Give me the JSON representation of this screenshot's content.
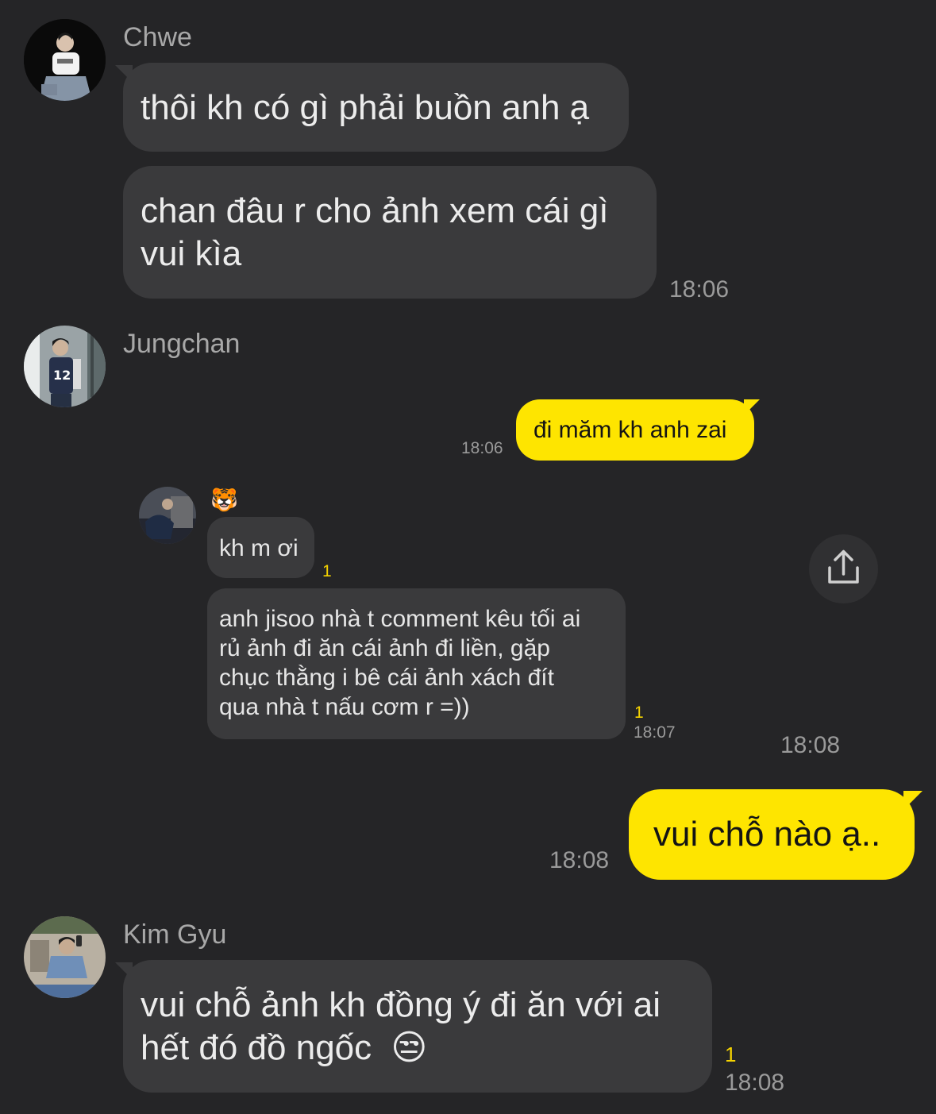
{
  "messages": {
    "chwe": {
      "sender": "Chwe",
      "bubble1": "thôi kh có gì phải buồn anh ạ",
      "bubble2_line1": "chan đâu r cho ảnh xem cái gì",
      "bubble2_line2": "vui kìa",
      "time": "18:06"
    },
    "jungchan": {
      "sender": "Jungchan",
      "shared_post": {
        "reply_text": "đi măm kh anh zai",
        "reply_time": "18:06",
        "inner_sender_emoji": "🐯",
        "inner_msg1": "kh m ơi",
        "inner_msg1_unread": "1",
        "inner_msg2_lines": [
          "anh jisoo nhà t comment kêu tối ai",
          "rủ ảnh đi ăn cái ảnh đi liền, gặp",
          "chục thằng i bê cái ảnh xách đít",
          "qua nhà t nấu cơm r =))"
        ],
        "inner_msg2_unread": "1",
        "inner_msg2_time": "18:07"
      },
      "time": "18:08"
    },
    "me": {
      "text": "vui chỗ nào ạ..",
      "time": "18:08"
    },
    "kimgyu": {
      "sender": "Kim Gyu",
      "line1": "vui chỗ ảnh kh đồng ý đi ăn với ai",
      "line2": "hết đó đồ ngốc",
      "emoji": "😒",
      "unread": "1",
      "time": "18:08"
    }
  },
  "icons": {
    "share": "share-icon"
  },
  "colors": {
    "background": "#252527",
    "bubble": "#3a3a3c",
    "my_bubble": "#fee500",
    "unread": "#f5d300"
  }
}
